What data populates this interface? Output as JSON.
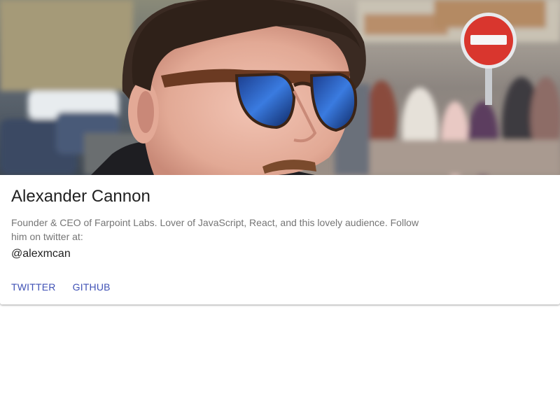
{
  "profile": {
    "name": "Alexander Cannon",
    "bio": "Founder & CEO of Farpoint Labs. Lover of JavaScript, React, and this lovely audience. Follow him on twitter at:",
    "handle": "@alexmcan"
  },
  "actions": {
    "twitter_label": "TWITTER",
    "github_label": "GITHUB"
  },
  "colors": {
    "accent": "#3f51b5",
    "title_text": "#212121",
    "body_text": "#757575"
  },
  "media": {
    "description_icon": "profile-photo"
  }
}
